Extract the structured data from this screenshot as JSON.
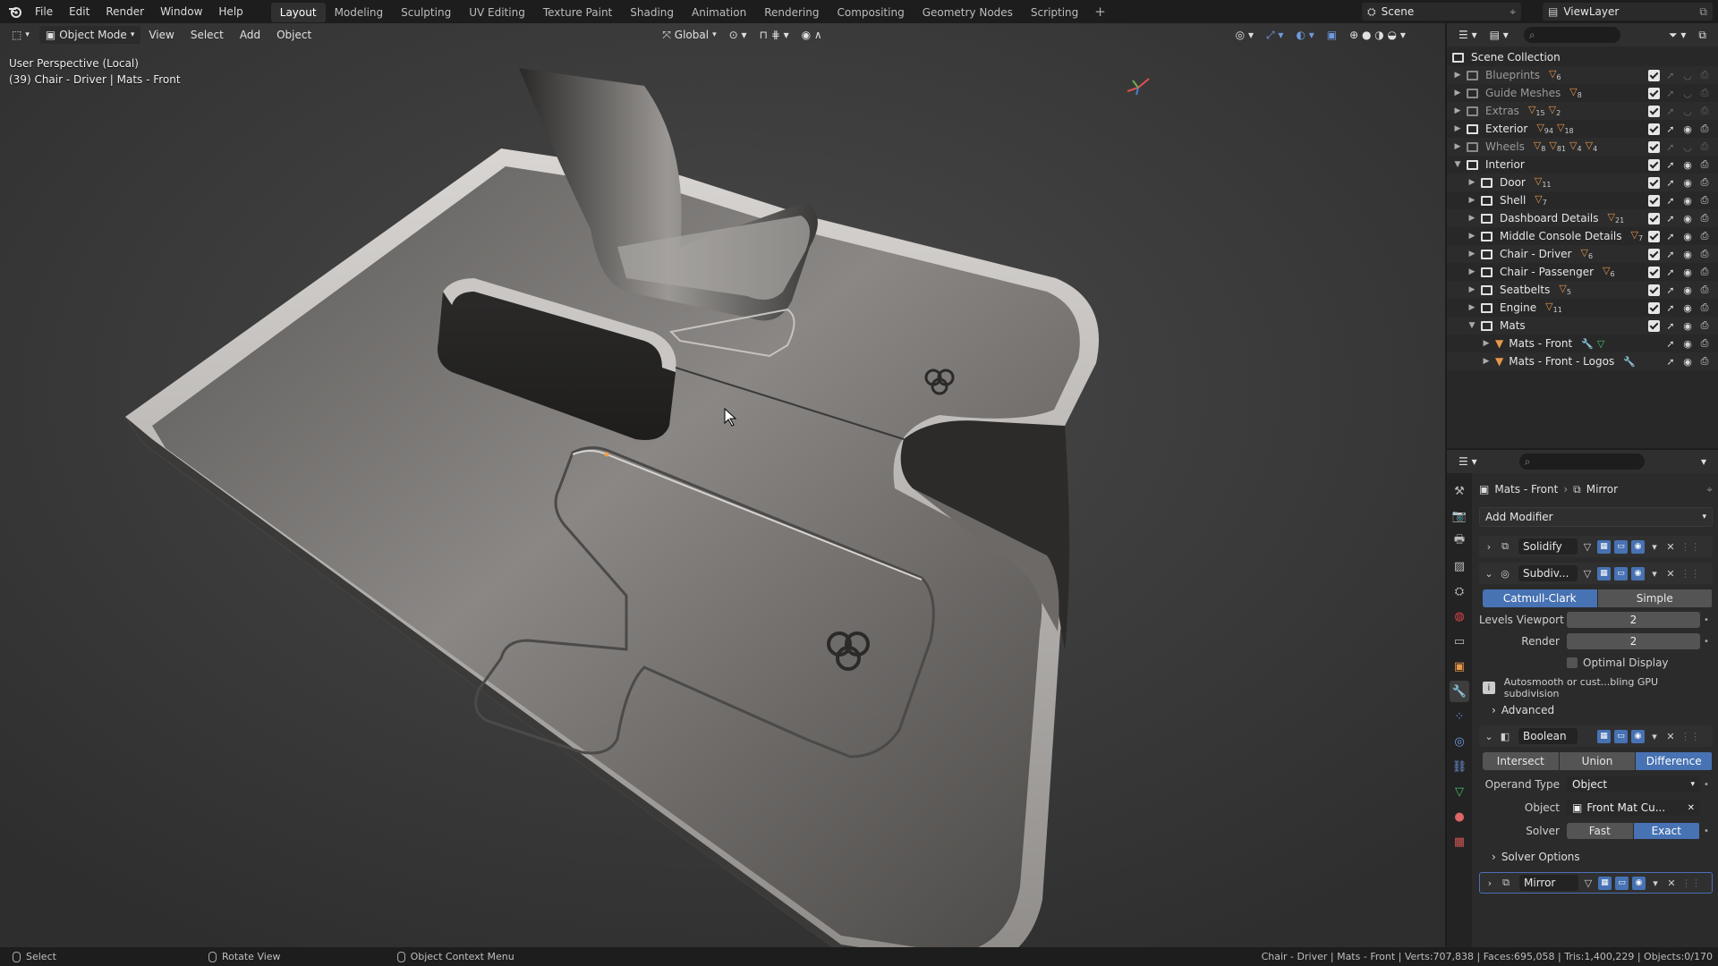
{
  "menubar": {
    "items": [
      "File",
      "Edit",
      "Render",
      "Window",
      "Help"
    ],
    "workspaces": [
      "Layout",
      "Modeling",
      "Sculpting",
      "UV Editing",
      "Texture Paint",
      "Shading",
      "Animation",
      "Rendering",
      "Compositing",
      "Geometry Nodes",
      "Scripting"
    ],
    "active_workspace": "Layout",
    "scene": "Scene",
    "view_layer": "ViewLayer"
  },
  "viewport": {
    "mode": "Object Mode",
    "menus": [
      "View",
      "Select",
      "Add",
      "Object"
    ],
    "transform_orientation": "Global",
    "info_line1": "User Perspective (Local)",
    "info_line2": "(39) Chair - Driver | Mats - Front",
    "logo_text": "ꝏ"
  },
  "outliner": {
    "root": "Scene Collection",
    "rows": [
      {
        "label": "Blueprints",
        "type": "collection",
        "dim": true,
        "badge": "6"
      },
      {
        "label": "Guide Meshes",
        "type": "collection",
        "dim": true,
        "badge": "8"
      },
      {
        "label": "Extras",
        "type": "collection",
        "dim": true,
        "badge": "15",
        "badge2": "2"
      },
      {
        "label": "Exterior",
        "type": "collection",
        "dim": false,
        "badge": "94",
        "badge2": "18"
      },
      {
        "label": "Wheels",
        "type": "collection",
        "dim": true,
        "badge": "8",
        "badge2": "81",
        "badge3": "4",
        "badge4": "4"
      },
      {
        "label": "Interior",
        "type": "collection",
        "dim": false
      },
      {
        "label": "Door",
        "type": "collection",
        "dim": false,
        "badge": "11"
      },
      {
        "label": "Shell",
        "type": "collection",
        "dim": false,
        "badge": "7"
      },
      {
        "label": "Dashboard Details",
        "type": "collection",
        "dim": false,
        "badge": "21"
      },
      {
        "label": "Middle Console Details",
        "type": "collection",
        "dim": false,
        "badge": "7"
      },
      {
        "label": "Chair - Driver",
        "type": "collection",
        "dim": false,
        "badge": "6"
      },
      {
        "label": "Chair - Passenger",
        "type": "collection",
        "dim": false,
        "badge": "6"
      },
      {
        "label": "Seatbelts",
        "type": "collection",
        "dim": false,
        "badge": "5"
      },
      {
        "label": "Engine",
        "type": "collection",
        "dim": false,
        "badge": "11"
      },
      {
        "label": "Mats",
        "type": "collection",
        "dim": false
      },
      {
        "label": "Mats - Front",
        "type": "mesh",
        "dim": false
      },
      {
        "label": "Mats - Front - Logos",
        "type": "mesh",
        "dim": false
      }
    ]
  },
  "properties": {
    "breadcrumb_object": "Mats - Front",
    "breadcrumb_modifier": "Mirror",
    "add_modifier": "Add Modifier",
    "solidify": {
      "name": "Solidify"
    },
    "subdiv": {
      "name": "Subdiv...",
      "types": [
        "Catmull-Clark",
        "Simple"
      ],
      "active_type": "Catmull-Clark",
      "levels_viewport_label": "Levels Viewport",
      "levels_viewport": "2",
      "render_label": "Render",
      "render": "2",
      "optimal_display": "Optimal Display",
      "warning": "Autosmooth or cust...bling GPU subdivision",
      "advanced": "Advanced"
    },
    "boolean": {
      "name": "Boolean",
      "ops": [
        "Intersect",
        "Union",
        "Difference"
      ],
      "active_op": "Difference",
      "operand_type_label": "Operand Type",
      "operand_type": "Object",
      "object_label": "Object",
      "object": "Front Mat Cu...",
      "solver_label": "Solver",
      "solvers": [
        "Fast",
        "Exact"
      ],
      "active_solver": "Exact",
      "solver_options": "Solver Options"
    },
    "mirror": {
      "name": "Mirror"
    }
  },
  "statusbar": {
    "select": "Select",
    "rotate": "Rotate View",
    "context": "Object Context Menu",
    "stats": "Chair - Driver | Mats - Front | Verts:707,838 | Faces:695,058 | Tris:1,400,229 | Objects:0/170"
  },
  "colors": {
    "accent": "#4772b3",
    "mesh_orange": "#e8964a",
    "viewport_bg": "#3d3d3d"
  }
}
